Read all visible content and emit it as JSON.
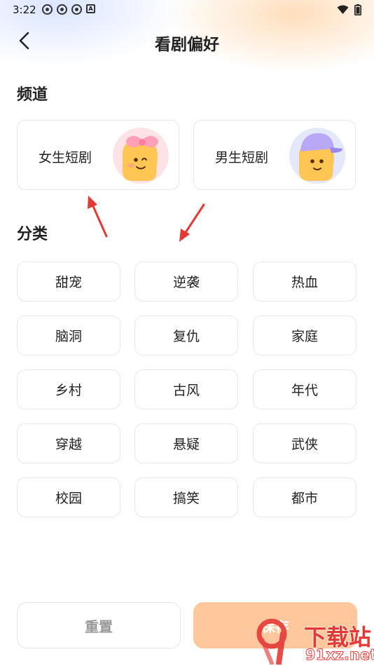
{
  "status_bar": {
    "time": "3:22"
  },
  "header": {
    "title": "看剧偏好"
  },
  "channel_section": {
    "title": "频道",
    "items": [
      {
        "label": "女生短剧",
        "avatar": "girl-avatar-with-bow"
      },
      {
        "label": "男生短剧",
        "avatar": "boy-avatar-with-cap"
      }
    ]
  },
  "category_section": {
    "title": "分类",
    "tags": [
      "甜宠",
      "逆袭",
      "热血",
      "脑洞",
      "复仇",
      "家庭",
      "乡村",
      "古风",
      "年代",
      "穿越",
      "悬疑",
      "武侠",
      "校园",
      "搞笑",
      "都市"
    ]
  },
  "footer": {
    "reset_label": "重置",
    "save_label": "保存"
  },
  "watermark": {
    "brand": "下载站",
    "domain": "91xz.net"
  },
  "colors": {
    "save_button": "#ffc79b",
    "annotation_arrow": "#e53935",
    "watermark": "#e53935"
  }
}
